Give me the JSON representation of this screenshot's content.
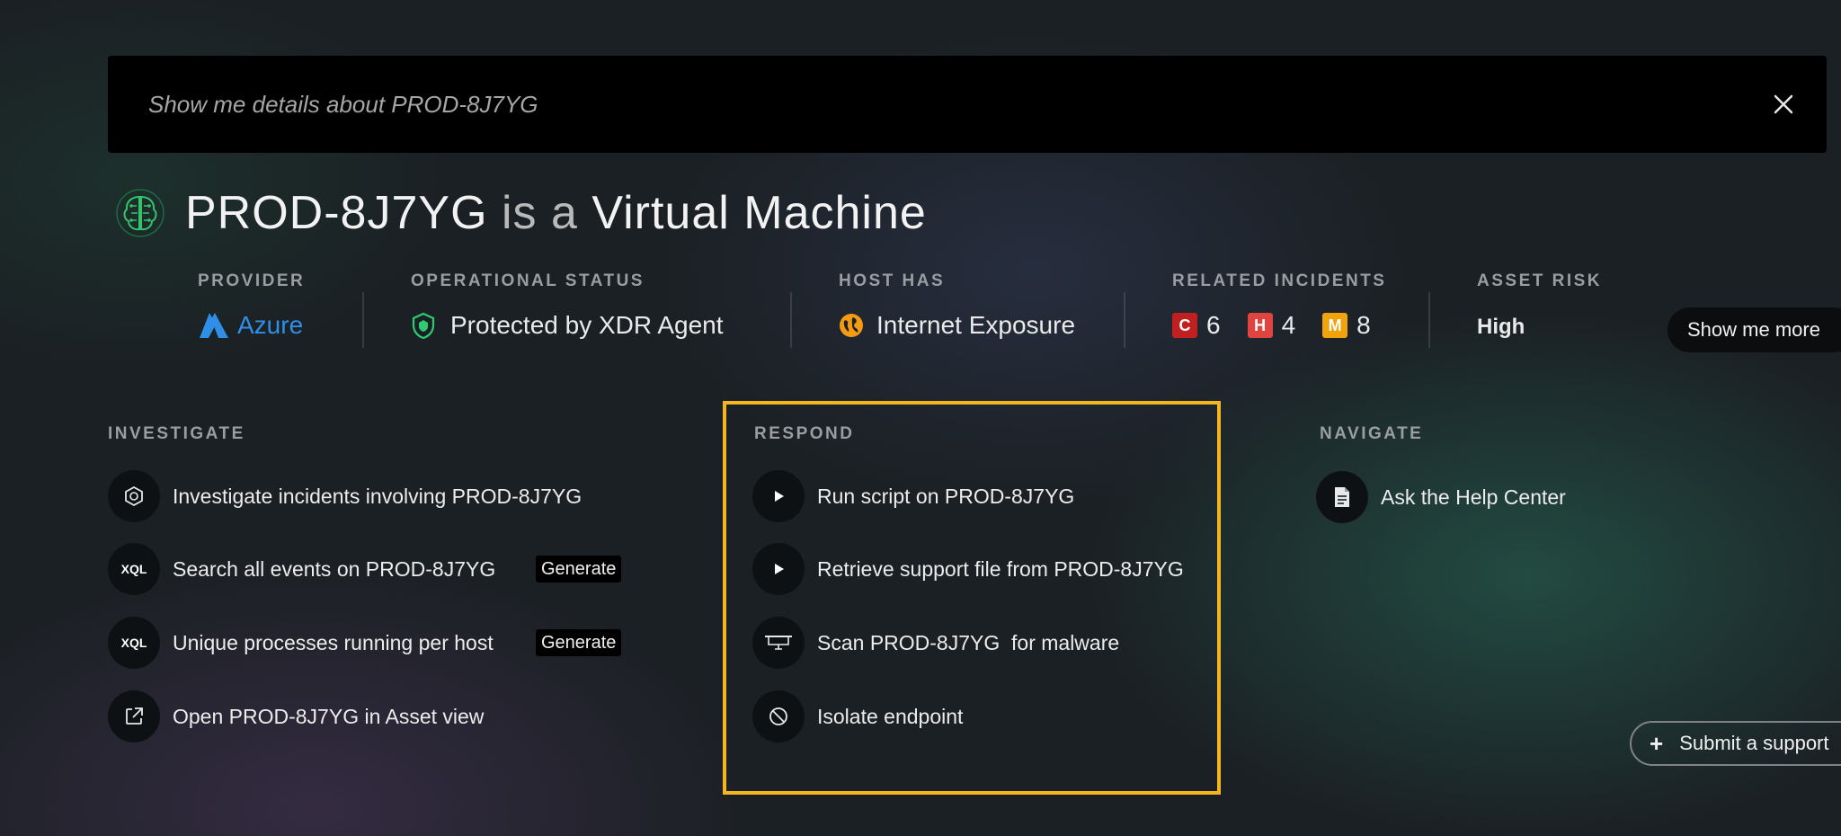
{
  "search": {
    "query": "Show me details about PROD-8J7YG"
  },
  "title": {
    "asset": "PROD-8J7YG",
    "connector": "is a",
    "type": "Virtual Machine"
  },
  "info": {
    "provider": {
      "label": "PROVIDER",
      "value": "Azure",
      "color": "#2f8fe6"
    },
    "status": {
      "label": "OPERATIONAL STATUS",
      "value": "Protected by XDR Agent",
      "icon": "shield-check-icon",
      "color": "#2ecc71"
    },
    "host_has": {
      "label": "HOST HAS",
      "value": "Internet Exposure",
      "icon": "globe-icon",
      "color": "#f39c12"
    },
    "incidents": {
      "label": "RELATED INCIDENTS",
      "items": [
        {
          "code": "C",
          "count": "6",
          "color": "#c0201f"
        },
        {
          "code": "H",
          "count": "4",
          "color": "#e0443e"
        },
        {
          "code": "M",
          "count": "8",
          "color": "#f0a30a"
        }
      ]
    },
    "risk": {
      "label": "ASSET RISK",
      "value": "High"
    },
    "show_more": "Show me more"
  },
  "investigate": {
    "heading": "INVESTIGATE",
    "items": [
      {
        "icon": "hexagon-icon",
        "text": "Investigate incidents involving PROD-8J7YG"
      },
      {
        "icon": "xql-icon",
        "icon_text": "XQL",
        "text": "Search all events on PROD-8J7YG",
        "action": "Generate"
      },
      {
        "icon": "xql-icon",
        "icon_text": "XQL",
        "text": "Unique processes running per host",
        "action": "Generate"
      },
      {
        "icon": "external-link-icon",
        "text": "Open PROD-8J7YG in Asset view"
      }
    ]
  },
  "respond": {
    "heading": "RESPOND",
    "highlight_color": "#f3b61f",
    "items": [
      {
        "icon": "play-icon",
        "text": "Run script on PROD-8J7YG"
      },
      {
        "icon": "play-icon",
        "text": "Retrieve support file from PROD-8J7YG"
      },
      {
        "icon": "monitor-scan-icon",
        "text": "Scan PROD-8J7YG  for malware"
      },
      {
        "icon": "block-icon",
        "text": "Isolate endpoint"
      }
    ]
  },
  "navigate": {
    "heading": "NAVIGATE",
    "items": [
      {
        "icon": "document-icon",
        "text": "Ask the Help Center"
      }
    ]
  },
  "submit_support": "Submit a support"
}
